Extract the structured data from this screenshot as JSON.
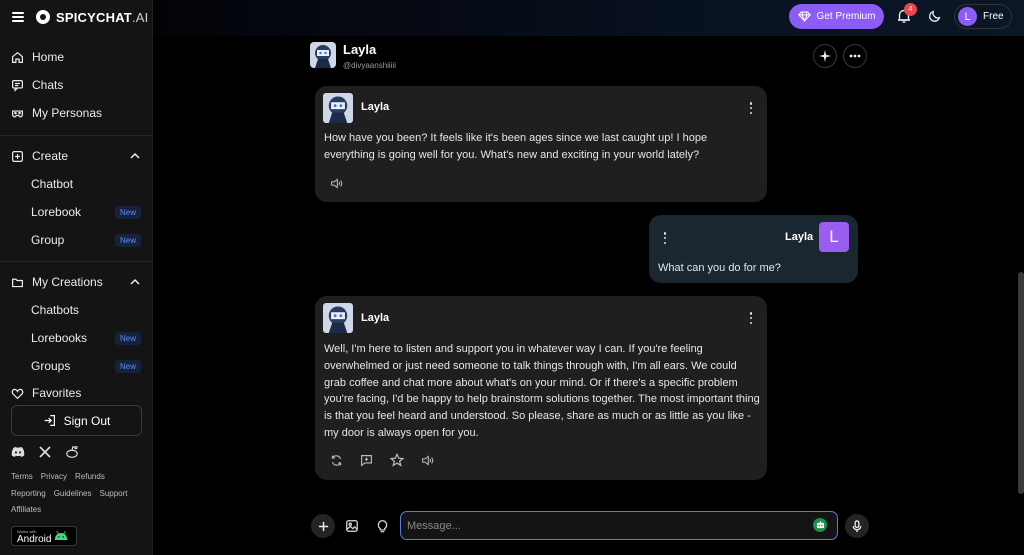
{
  "brand": {
    "name_main": "SPICYCHAT",
    "name_suffix": ".AI"
  },
  "sidebar": {
    "items": [
      {
        "label": "Home",
        "icon": "home-icon"
      },
      {
        "label": "Chats",
        "icon": "chat-icon"
      },
      {
        "label": "My Personas",
        "icon": "mask-icon"
      },
      {
        "label": "Create",
        "icon": "plus-square-icon"
      },
      {
        "label": "Chatbot"
      },
      {
        "label": "Lorebook",
        "badge": "New"
      },
      {
        "label": "Group",
        "badge": "New"
      },
      {
        "label": "My Creations",
        "icon": "folder-icon"
      },
      {
        "label": "Chatbots"
      },
      {
        "label": "Lorebooks",
        "badge": "New"
      },
      {
        "label": "Groups",
        "badge": "New"
      },
      {
        "label": "Favorites",
        "icon": "heart-icon"
      }
    ],
    "sign_out": "Sign Out",
    "footer_links": [
      "Terms",
      "Privacy",
      "Refunds",
      "Reporting",
      "Guidelines",
      "Support",
      "Affiliates"
    ],
    "android_small": "Works with",
    "android_big": "Android"
  },
  "topbar": {
    "premium_label": "Get Premium",
    "notification_count": "4",
    "account_initial": "L",
    "account_plan": "Free"
  },
  "chat": {
    "bot_name": "Layla",
    "handle": "@divyaanshiiiii",
    "messages": [
      {
        "author": "Layla",
        "text": "How have you been? It feels like it's been ages since we last caught up! I hope everything is going well for you. What's new and exciting in your world lately?"
      },
      {
        "author": "Layla",
        "initial": "L",
        "text": "What can you do for me?"
      },
      {
        "author": "Layla",
        "text": "Well, I'm here to listen and support you in whatever way I can. If you're feeling overwhelmed or just need someone to talk things through with, I'm all ears. We could grab coffee and chat more about what's on your mind. Or if there's a specific problem you're facing, I'd be happy to help brainstorm solutions together. The most important thing is that you feel heard and understood. So please, share as much or as little as you like - my door is always open for you."
      }
    ]
  },
  "composer": {
    "placeholder": "Message..."
  },
  "colors": {
    "accent": "#8b5cf6",
    "input_border": "#5b7bd6",
    "badge_red": "#e5484d"
  }
}
